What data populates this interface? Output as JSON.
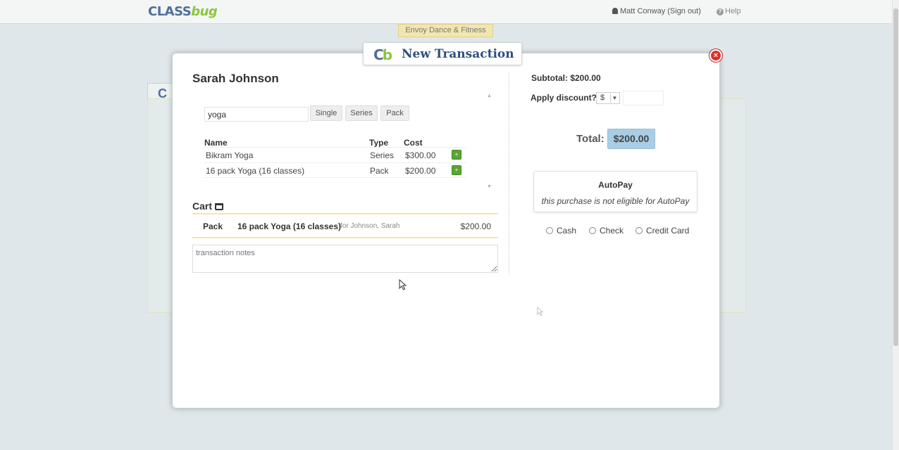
{
  "header": {
    "logo_a": "CLASS",
    "logo_b": "bug",
    "user_label": "Matt Conway (Sign out)",
    "help_label": "Help"
  },
  "background": {
    "studio": "Envoy Dance & Fitness",
    "tab_letter": "C"
  },
  "modal": {
    "title": "New Transaction",
    "logo_c": "C",
    "logo_b": "b",
    "close_glyph": "×",
    "customer": "Sarah Johnson",
    "search": {
      "value": "yoga"
    },
    "filters": [
      "Single",
      "Series",
      "Pack"
    ],
    "table": {
      "headers": {
        "name": "Name",
        "type": "Type",
        "cost": "Cost"
      },
      "rows": [
        {
          "name": "Bikram Yoga",
          "type": "Series",
          "cost": "$300.00"
        },
        {
          "name": "16 pack Yoga (16 classes)",
          "type": "Pack",
          "cost": "$200.00"
        }
      ],
      "add_glyph": "+"
    },
    "cart": {
      "heading": "Cart",
      "item": {
        "type": "Pack",
        "name": "16 pack Yoga (16 classes)",
        "for": "for Johnson, Sarah",
        "price": "$200.00"
      }
    },
    "notes": {
      "placeholder": "transaction notes"
    },
    "summary": {
      "subtotal": "Subtotal: $200.00",
      "discount_label": "Apply discount?",
      "discount_unit": "$",
      "total_label": "Total:",
      "total_value": "$200.00"
    },
    "autopay": {
      "heading": "AutoPay",
      "text": "this purchase is not eligible for AutoPay"
    },
    "payment_methods": [
      "Cash",
      "Check",
      "Credit Card"
    ]
  },
  "colors": {
    "brand_blue": "#4f6fa0",
    "brand_green": "#8cc63f",
    "total_bg": "#a8cde4",
    "close_red": "#e0302a"
  }
}
